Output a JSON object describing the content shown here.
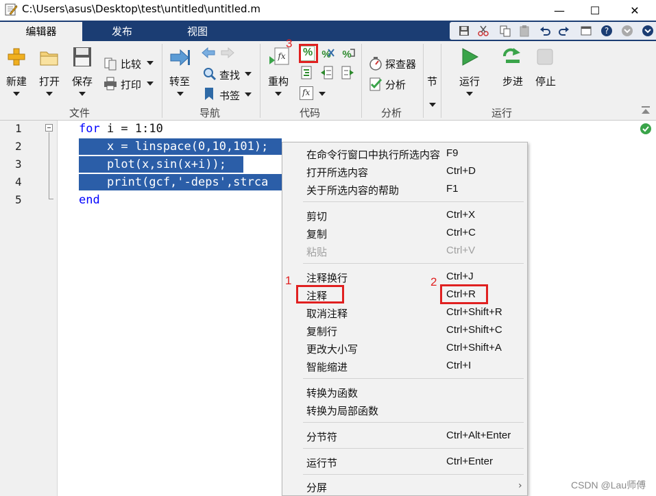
{
  "window": {
    "title": "C:\\Users\\asus\\Desktop\\test\\untitled\\untitled.m",
    "minimize": "—",
    "maximize": "☐",
    "close": "✕"
  },
  "tabs": [
    {
      "label": "编辑器",
      "active": true
    },
    {
      "label": "发布",
      "active": false
    },
    {
      "label": "视图",
      "active": false
    }
  ],
  "ribbon": {
    "file": {
      "group_label": "文件",
      "new_label": "新建",
      "open_label": "打开",
      "save_label": "保存",
      "compare_label": "比较",
      "print_label": "打印"
    },
    "navigate": {
      "group_label": "导航",
      "goto_label": "转至",
      "find_label": "查找",
      "bookmark_label": "书签"
    },
    "code": {
      "group_label": "代码",
      "refactor_label": "重构",
      "comment_glyph": "%",
      "fx_glyph": "fx"
    },
    "analyze": {
      "group_label": "分析",
      "explorer_label": "探查器",
      "analyze_label": "分析"
    },
    "section": {
      "label": "节"
    },
    "run": {
      "group_label": "运行",
      "run_label": "运行",
      "step_label": "步进",
      "stop_label": "停止"
    }
  },
  "editor": {
    "line_numbers": [
      "1",
      "2",
      "3",
      "4",
      "5"
    ],
    "lines": {
      "l1_kw": "for",
      "l1_rest": " i = 1:10",
      "l2": "    x = linspace(0,10,101);",
      "l3": "    plot(x,sin(x+i));",
      "l4": "    print(gcf,'-deps',strca",
      "l5_kw": "end"
    }
  },
  "context_menu": {
    "items": [
      {
        "label": "在命令行窗口中执行所选内容",
        "shortcut": "F9"
      },
      {
        "label": "打开所选内容",
        "shortcut": "Ctrl+D"
      },
      {
        "label": "关于所选内容的帮助",
        "shortcut": "F1"
      },
      {
        "label": "剪切",
        "shortcut": "Ctrl+X"
      },
      {
        "label": "复制",
        "shortcut": "Ctrl+C"
      },
      {
        "label": "粘贴",
        "shortcut": "Ctrl+V"
      },
      {
        "label": "注释换行",
        "shortcut": "Ctrl+J"
      },
      {
        "label": "注释",
        "shortcut": "Ctrl+R"
      },
      {
        "label": "取消注释",
        "shortcut": "Ctrl+Shift+R"
      },
      {
        "label": "复制行",
        "shortcut": "Ctrl+Shift+C"
      },
      {
        "label": "更改大小写",
        "shortcut": "Ctrl+Shift+A"
      },
      {
        "label": "智能缩进",
        "shortcut": "Ctrl+I"
      },
      {
        "label": "转换为函数",
        "shortcut": ""
      },
      {
        "label": "转换为局部函数",
        "shortcut": ""
      },
      {
        "label": "分节符",
        "shortcut": "Ctrl+Alt+Enter"
      },
      {
        "label": "运行节",
        "shortcut": "Ctrl+Enter"
      },
      {
        "label": "分屏",
        "shortcut": "›"
      }
    ]
  },
  "annotations": {
    "n1": "1",
    "n2": "2",
    "n3": "3",
    "color": "#e02020"
  },
  "watermark": "CSDN @Lau师傅",
  "colors": {
    "tabstrip": "#1b3d73",
    "selection": "#2b5ea8",
    "keyword": "#0000ff",
    "run_green": "#3aa44a"
  }
}
